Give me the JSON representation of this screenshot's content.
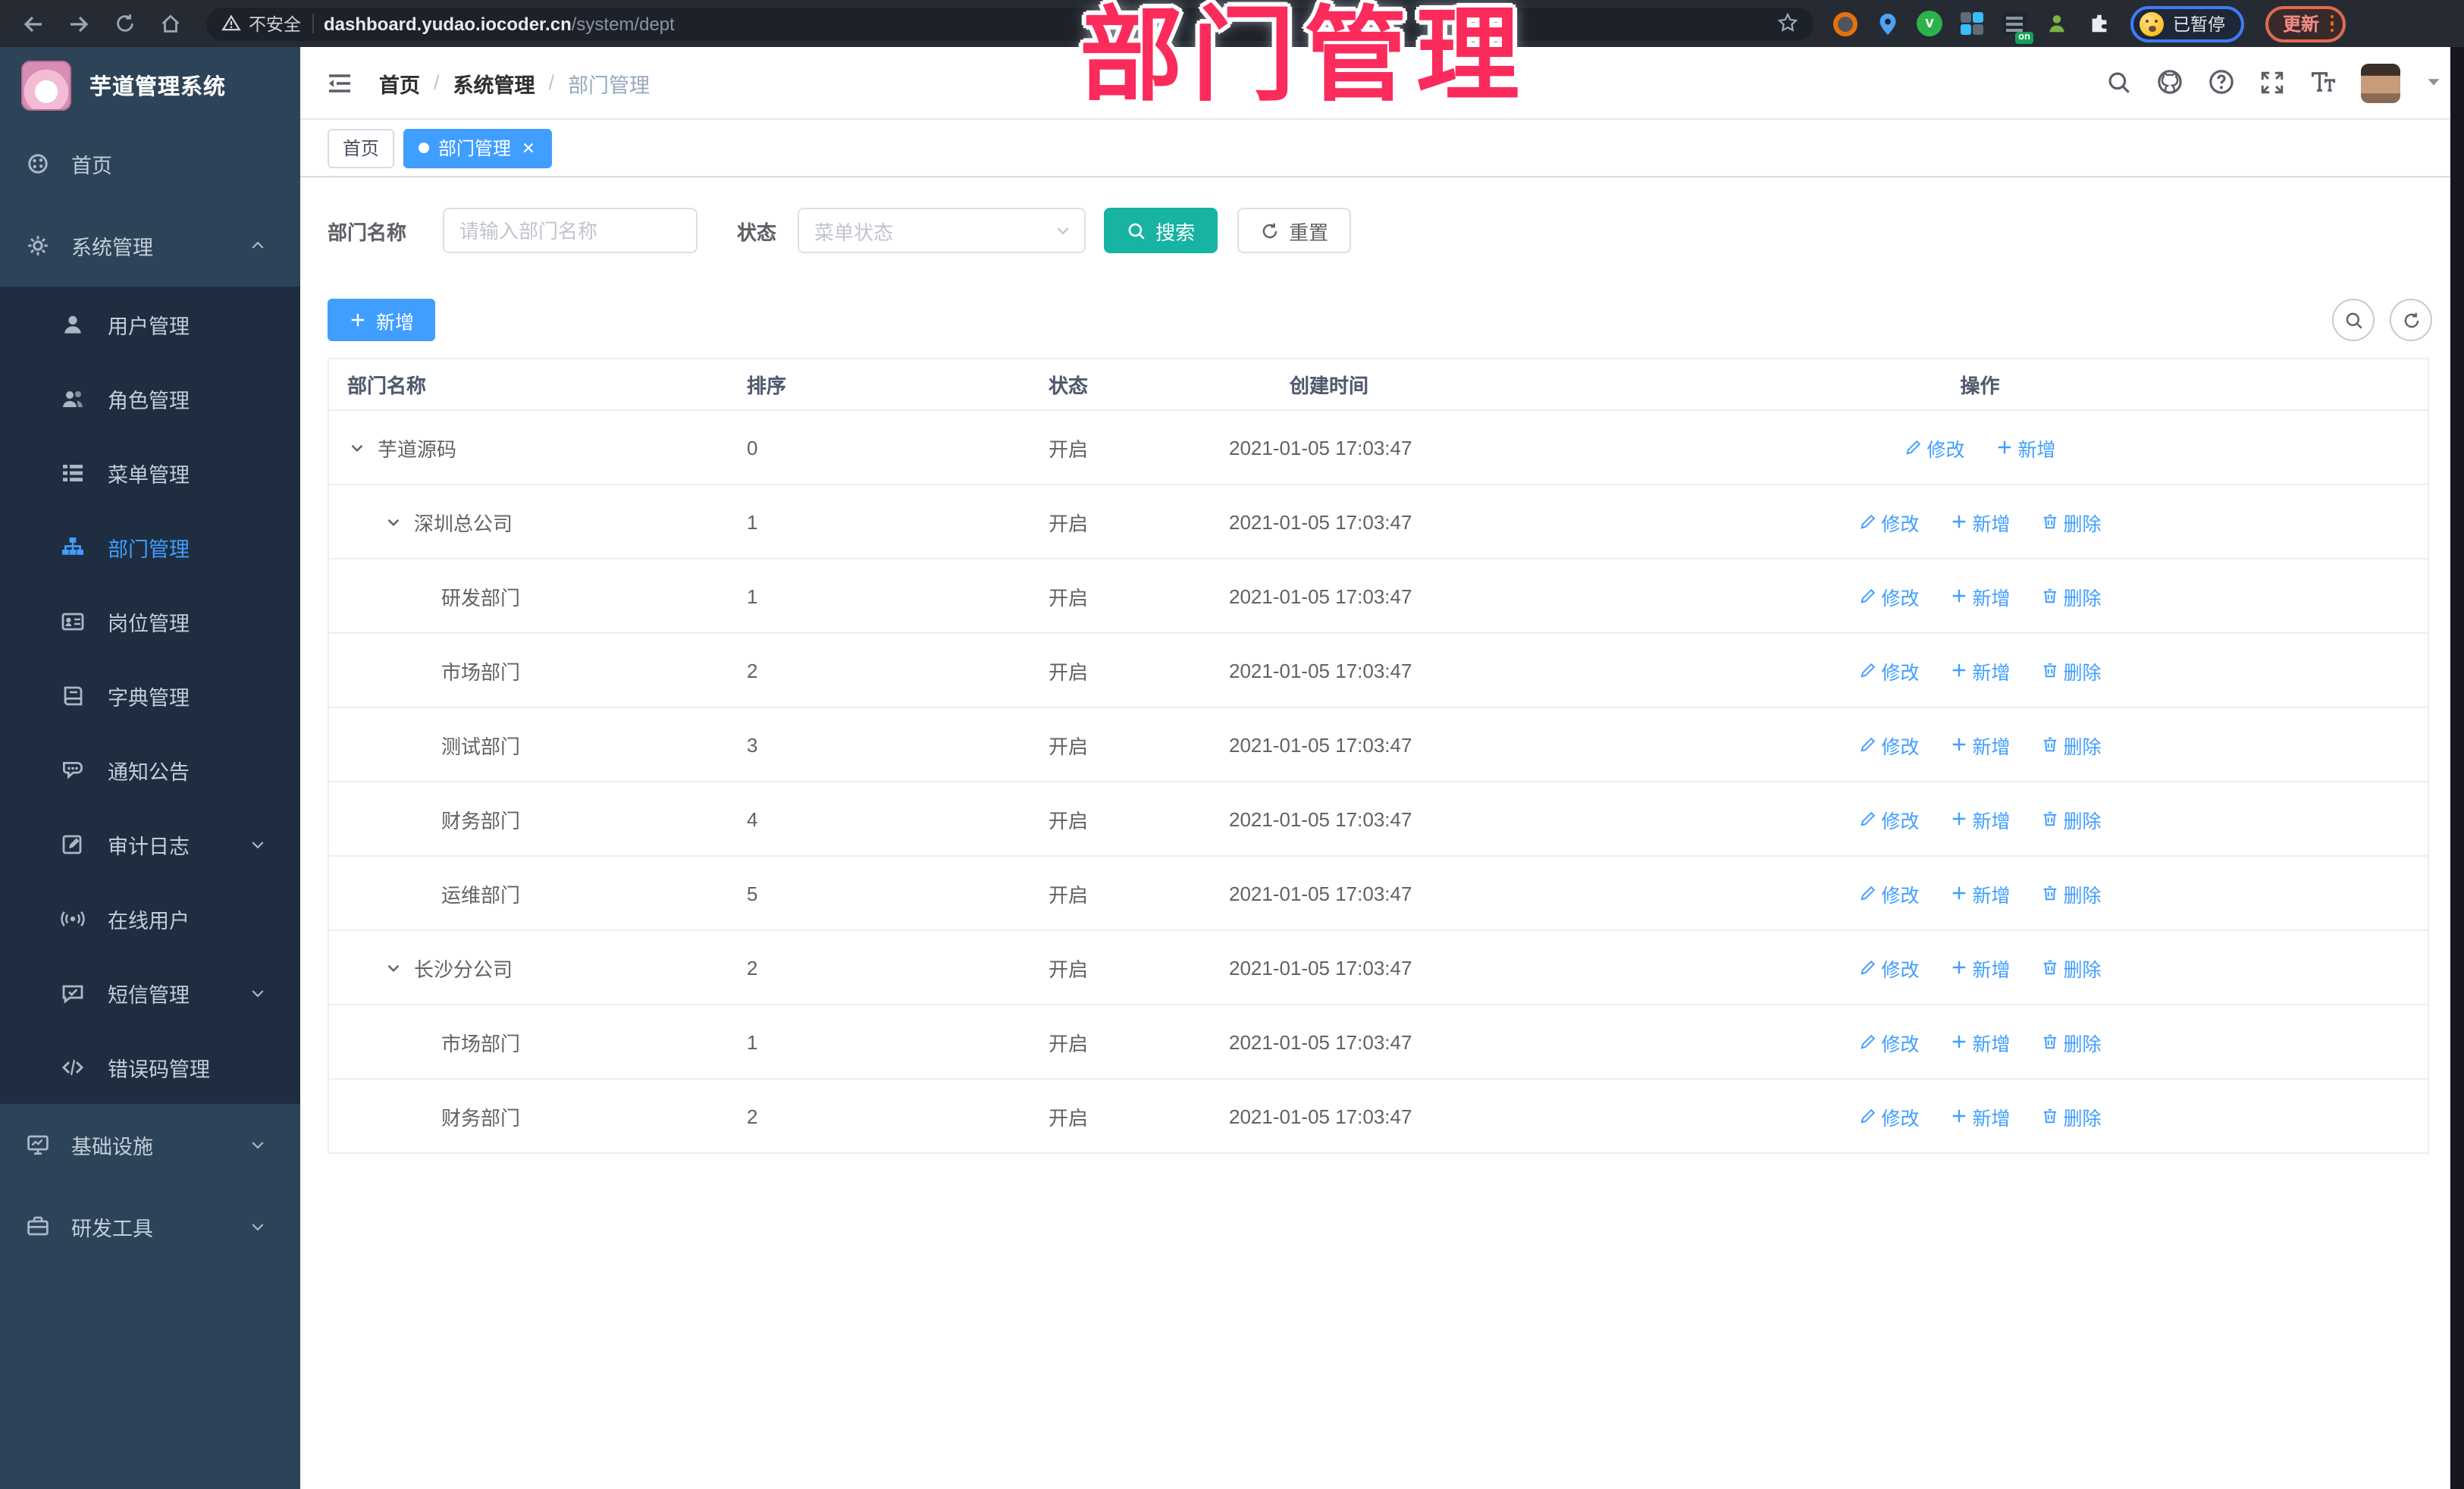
{
  "colors": {
    "primary": "#409eff",
    "search_button": "#17b3a3",
    "overlay": "#fb2b5c",
    "sidebar_bg": "#2d4357",
    "sidebar_submenu_bg": "#1f2d40",
    "sidebar_text": "#c2cfdb",
    "browser_bar_bg": "#262b33",
    "link": "#409eff"
  },
  "overlay_title": "部门管理",
  "browser": {
    "nav_icons": [
      "back-icon",
      "forward-icon",
      "reload-icon",
      "home-icon"
    ],
    "security_label": "不安全",
    "url_host": "dashboard.yudao.iocoder.cn",
    "url_path": "/system/dept",
    "extensions": [
      "target-extension-icon",
      "pin-extension-icon",
      "green-check-extension-icon",
      "grid-extension-icon",
      "list-extension-icon",
      "person-extension-icon",
      "puzzle-extensions-icon"
    ],
    "extension_badge": "on",
    "profile_status": "已暂停",
    "update_label": "更新"
  },
  "sidebar": {
    "logo_title": "芋道管理系统",
    "menu": [
      {
        "id": "home",
        "label": "首页",
        "icon": "home",
        "level": 0
      },
      {
        "id": "system",
        "label": "系统管理",
        "icon": "gear",
        "level": 0,
        "arrow": "up"
      },
      {
        "id": "user",
        "label": "用户管理",
        "icon": "user",
        "level": 1
      },
      {
        "id": "role",
        "label": "角色管理",
        "icon": "users",
        "level": 1
      },
      {
        "id": "menu",
        "label": "菜单管理",
        "icon": "menu-list",
        "level": 1
      },
      {
        "id": "dept",
        "label": "部门管理",
        "icon": "org-tree",
        "level": 1,
        "active": true
      },
      {
        "id": "post",
        "label": "岗位管理",
        "icon": "id-card",
        "level": 1
      },
      {
        "id": "dict",
        "label": "字典管理",
        "icon": "dictionary",
        "level": 1
      },
      {
        "id": "notice",
        "label": "通知公告",
        "icon": "announcement",
        "level": 1
      },
      {
        "id": "audit-log",
        "label": "审计日志",
        "icon": "audit-log",
        "level": 1,
        "arrow": "down"
      },
      {
        "id": "online-user",
        "label": "在线用户",
        "icon": "online-user",
        "level": 1
      },
      {
        "id": "sms",
        "label": "短信管理",
        "icon": "sms",
        "level": 1,
        "arrow": "down"
      },
      {
        "id": "error-code",
        "label": "错误码管理",
        "icon": "error-code",
        "level": 1
      },
      {
        "id": "infra",
        "label": "基础设施",
        "icon": "infrastructure",
        "level": 0,
        "arrow": "down"
      },
      {
        "id": "dev-tools",
        "label": "研发工具",
        "icon": "dev-tools",
        "level": 0,
        "arrow": "down"
      }
    ]
  },
  "header": {
    "breadcrumb": [
      "首页",
      "系统管理",
      "部门管理"
    ],
    "action_icons": [
      "search-icon",
      "github-icon",
      "help-icon",
      "fullscreen-icon",
      "font-size-icon"
    ]
  },
  "tabs": [
    {
      "label": "首页",
      "active": false
    },
    {
      "label": "部门管理",
      "active": true,
      "closable": true
    }
  ],
  "filters": {
    "name_label": "部门名称",
    "name_placeholder": "请输入部门名称",
    "name_value": "",
    "status_label": "状态",
    "status_placeholder": "菜单状态",
    "search_label": "搜索",
    "reset_label": "重置"
  },
  "toolbar": {
    "add_label": "新增",
    "mini_buttons": [
      "search-icon",
      "refresh-icon"
    ]
  },
  "table": {
    "columns": [
      "部门名称",
      "排序",
      "状态",
      "创建时间",
      "操作"
    ],
    "action_labels": {
      "edit": "修改",
      "add": "新增",
      "delete": "删除"
    },
    "rows": [
      {
        "name": "芋道源码",
        "level": 0,
        "expandable": true,
        "sort": "0",
        "status": "开启",
        "created": "2021-01-05 17:03:47",
        "actions": [
          "edit",
          "add"
        ]
      },
      {
        "name": "深圳总公司",
        "level": 1,
        "expandable": true,
        "sort": "1",
        "status": "开启",
        "created": "2021-01-05 17:03:47",
        "actions": [
          "edit",
          "add",
          "delete"
        ]
      },
      {
        "name": "研发部门",
        "level": 2,
        "expandable": false,
        "sort": "1",
        "status": "开启",
        "created": "2021-01-05 17:03:47",
        "actions": [
          "edit",
          "add",
          "delete"
        ]
      },
      {
        "name": "市场部门",
        "level": 2,
        "expandable": false,
        "sort": "2",
        "status": "开启",
        "created": "2021-01-05 17:03:47",
        "actions": [
          "edit",
          "add",
          "delete"
        ]
      },
      {
        "name": "测试部门",
        "level": 2,
        "expandable": false,
        "sort": "3",
        "status": "开启",
        "created": "2021-01-05 17:03:47",
        "actions": [
          "edit",
          "add",
          "delete"
        ]
      },
      {
        "name": "财务部门",
        "level": 2,
        "expandable": false,
        "sort": "4",
        "status": "开启",
        "created": "2021-01-05 17:03:47",
        "actions": [
          "edit",
          "add",
          "delete"
        ]
      },
      {
        "name": "运维部门",
        "level": 2,
        "expandable": false,
        "sort": "5",
        "status": "开启",
        "created": "2021-01-05 17:03:47",
        "actions": [
          "edit",
          "add",
          "delete"
        ]
      },
      {
        "name": "长沙分公司",
        "level": 1,
        "expandable": true,
        "sort": "2",
        "status": "开启",
        "created": "2021-01-05 17:03:47",
        "actions": [
          "edit",
          "add",
          "delete"
        ]
      },
      {
        "name": "市场部门",
        "level": 2,
        "expandable": false,
        "sort": "1",
        "status": "开启",
        "created": "2021-01-05 17:03:47",
        "actions": [
          "edit",
          "add",
          "delete"
        ]
      },
      {
        "name": "财务部门",
        "level": 2,
        "expandable": false,
        "sort": "2",
        "status": "开启",
        "created": "2021-01-05 17:03:47",
        "actions": [
          "edit",
          "add",
          "delete"
        ]
      }
    ]
  }
}
